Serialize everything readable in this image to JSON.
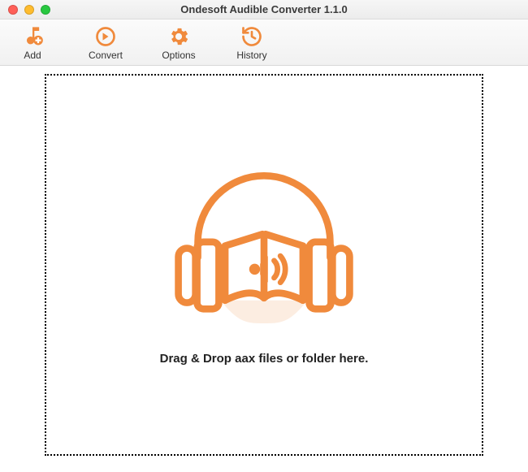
{
  "window": {
    "title": "Ondesoft Audible Converter 1.1.0"
  },
  "colors": {
    "accent": "#f08a3c"
  },
  "toolbar": {
    "add_label": "Add",
    "convert_label": "Convert",
    "options_label": "Options",
    "history_label": "History"
  },
  "dropzone": {
    "message": "Drag & Drop aax files or folder here."
  }
}
